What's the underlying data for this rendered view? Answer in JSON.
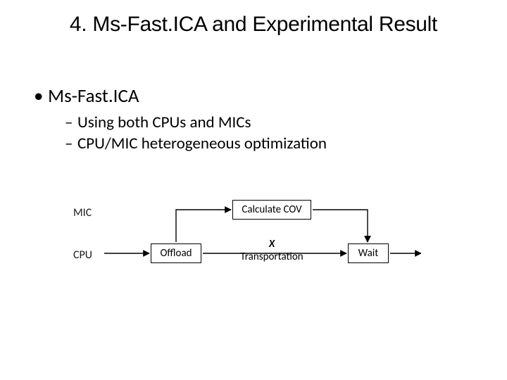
{
  "title": "4.  Ms-Fast.ICA and Experimental Result",
  "bullets": {
    "l1": "Ms-Fast.ICA",
    "l2_a": "Using both CPUs and MICs",
    "l2_b": "CPU/MIC heterogeneous optimization"
  },
  "diagram": {
    "row_mic": "MIC",
    "row_cpu": "CPU",
    "box_cov": "Calculate COV",
    "box_offload": "Offload",
    "box_wait": "Wait",
    "x_top": "X",
    "x_bottom": "Transportation"
  }
}
